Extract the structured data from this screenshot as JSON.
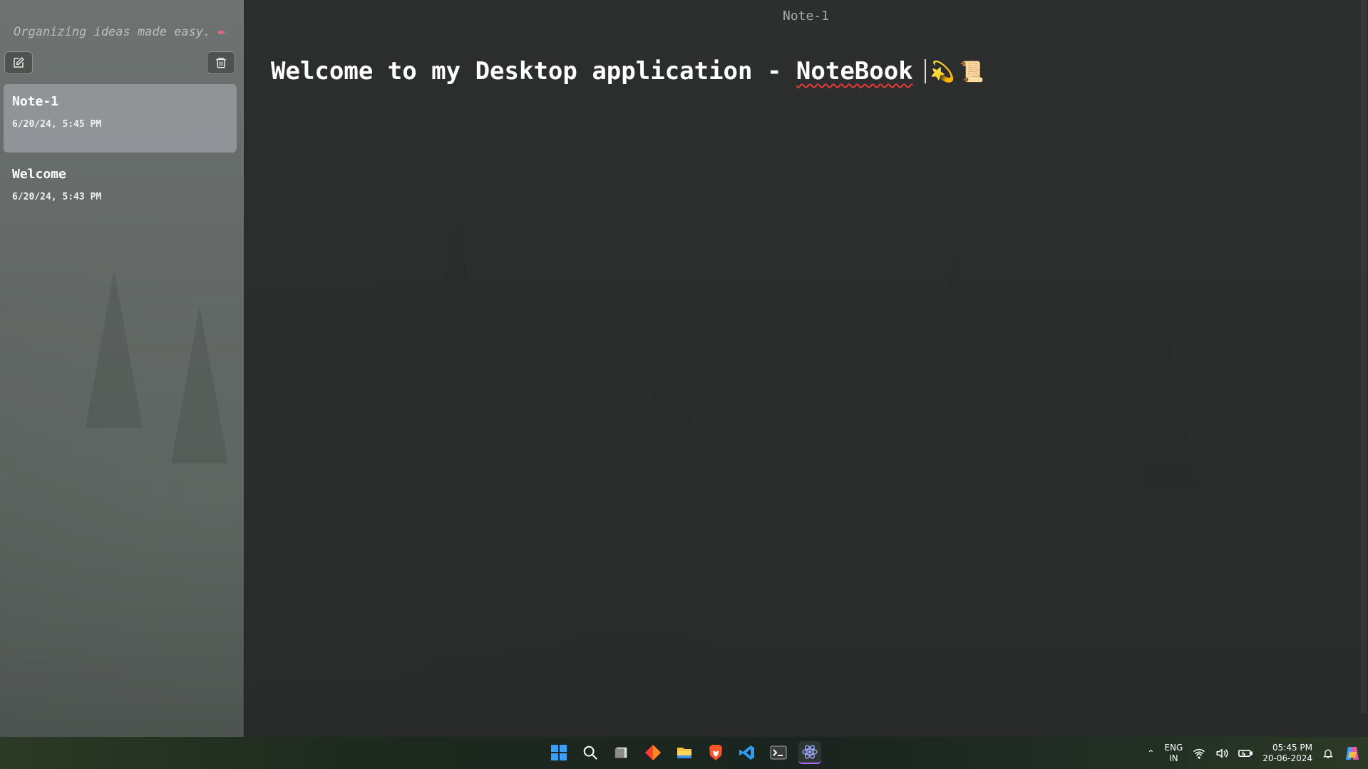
{
  "sidebar": {
    "tagline": "Organizing ideas made easy.",
    "tagline_icon": "✒",
    "new_note_icon": "compose-icon",
    "delete_note_icon": "trash-icon",
    "notes": [
      {
        "title": "Note-1",
        "date": "6/20/24, 5:45 PM",
        "selected": true
      },
      {
        "title": "Welcome",
        "date": "6/20/24, 5:43 PM",
        "selected": false
      }
    ]
  },
  "editor": {
    "title": "Note-1",
    "content_prefix": "Welcome to my Desktop application - ",
    "content_word_misspelled": "NoteBook",
    "emoji_1": "💫",
    "emoji_2": "📜"
  },
  "taskbar": {
    "apps": [
      "windows-start",
      "search",
      "task-view",
      "app-diamond",
      "file-explorer",
      "brave-browser",
      "vscode",
      "terminal",
      "electron-app"
    ],
    "tray": {
      "lang_top": "ENG",
      "lang_bottom": "IN",
      "time": "05:45 PM",
      "date": "20-06-2024"
    }
  },
  "colors": {
    "accent_underline": "#e53935",
    "selected_note_bg": "#a0a2a8"
  }
}
